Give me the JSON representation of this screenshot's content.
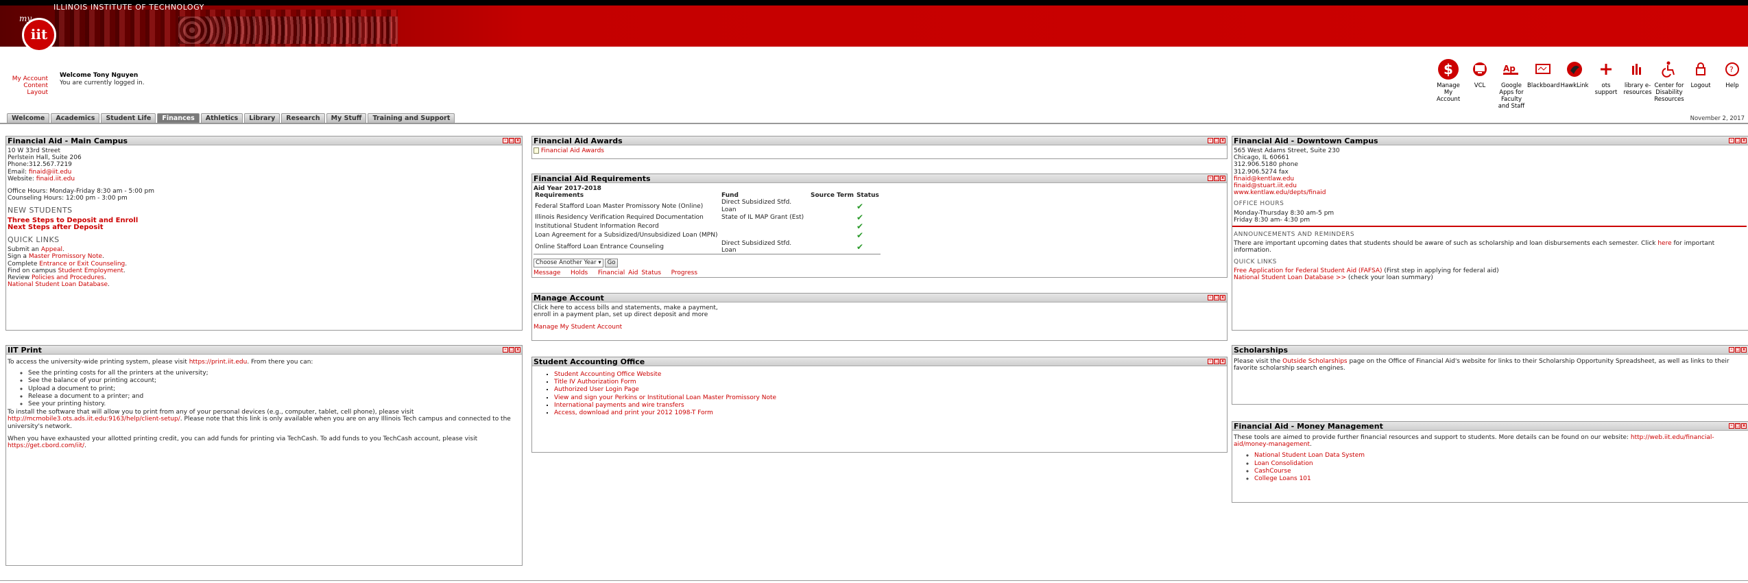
{
  "header": {
    "institution": "ILLINOIS INSTITUTE OF TECHNOLOGY",
    "logo_prefix": "my",
    "logo_text": "iit"
  },
  "user": {
    "my_account": "My Account",
    "content_layout": "Content Layout",
    "welcome": "Welcome Tony Nguyen",
    "logged_in": "You are currently logged in."
  },
  "toolbar": [
    {
      "label": "Manage My Account",
      "icon": "dollar-icon"
    },
    {
      "label": "VCL",
      "icon": "monitor-icon"
    },
    {
      "label": "Google Apps for Faculty and Staff",
      "icon": "google-apps-icon"
    },
    {
      "label": "Blackboard",
      "icon": "blackboard-icon"
    },
    {
      "label": "HawkLink",
      "icon": "hawklink-icon"
    },
    {
      "label": "ots support",
      "icon": "ots-icon"
    },
    {
      "label": "library e-resources",
      "icon": "library-icon"
    },
    {
      "label": "Center for Disability Resources",
      "icon": "accessibility-icon"
    },
    {
      "label": "Logout",
      "icon": "lock-icon"
    },
    {
      "label": "Help",
      "icon": "help-icon"
    }
  ],
  "tabs": [
    "Welcome",
    "Academics",
    "Student Life",
    "Finances",
    "Athletics",
    "Library",
    "Research",
    "My Stuff",
    "Training and Support"
  ],
  "date": "November 2, 2017",
  "fa_main": {
    "title": "Financial Aid - Main Campus",
    "address1": "10 W 33rd Street",
    "address2": "Perlstein Hall, Suite 206",
    "phone": "Phone:312.567.7219",
    "email_label": "Email: ",
    "email": "finaid@iit.edu",
    "website_label": "Website: ",
    "website": "finaid.iit.edu",
    "office_hours": "Office Hours: Monday-Friday 8:30 am - 5:00 pm",
    "counseling_hours": "Counseling Hours: 12:00 pm - 3:00 pm",
    "new_students": "NEW STUDENTS",
    "three_steps": "Three Steps to Deposit and Enroll",
    "next_steps": "Next Steps after Deposit",
    "quick_links": "QUICK LINKS",
    "ql": [
      {
        "pre": "Submit an ",
        "link": "Appeal",
        "post": "."
      },
      {
        "pre": "Sign a ",
        "link": "Master Promissory Note",
        "post": "."
      },
      {
        "pre": "Complete ",
        "link": "Entrance or Exit Counseling",
        "post": "."
      },
      {
        "pre": "Find on campus ",
        "link": "Student Employment",
        "post": "."
      },
      {
        "pre": "Review ",
        "link": "Policies and Procedures",
        "post": "."
      },
      {
        "pre": "",
        "link": "National Student Loan Database",
        "post": "."
      }
    ]
  },
  "iit_print": {
    "title": "IIT Print",
    "intro_pre": "To access the university-wide printing system, please visit ",
    "intro_link": "https://print.iit.edu",
    "intro_post": ". From there you can:",
    "items": [
      "See the printing costs for all the printers at the university;",
      "See the balance of your printing account;",
      "Upload a document to print;",
      "Release a document to a printer; and",
      "See your printing history."
    ],
    "install_pre": "To install the software that will allow you to print from any of your personal devices (e.g., computer, tablet, cell phone), please visit ",
    "install_link": "http://mcmobile3.ots.ads.iit.edu:9163/help/client-setup/",
    "install_post": ". Please note that this link is only available when you are on any Illinois Tech campus and connected to the university's network.",
    "funds_pre": "When you have exhausted your allotted printing credit, you can add funds for printing via TechCash. To add funds to you TechCash account, please visit ",
    "funds_link": "https://get.cbord.com/iit/",
    "funds_post": "."
  },
  "fa_awards": {
    "title": "Financial Aid Awards",
    "link": "Financial Aid Awards"
  },
  "fa_req": {
    "title": "Financial Aid Requirements",
    "aid_year": "Aid Year 2017-2018",
    "headers": [
      "Requirements",
      "Fund",
      "Source Term",
      "Status"
    ],
    "rows": [
      {
        "req": "Federal Stafford Loan Master Promissory Note (Online)",
        "fund": "Direct Subsidized Stfd. Loan"
      },
      {
        "req": "Illinois Residency Verification Required Documentation",
        "fund": "State of IL MAP Grant (Est)"
      },
      {
        "req": "Institutional Student Information Record",
        "fund": ""
      },
      {
        "req": "Loan Agreement for a Subsidized/Unsubsidized Loan (MPN)",
        "fund": ""
      },
      {
        "req": "Online Stafford Loan Entrance Counseling",
        "fund": "Direct Subsidized Stfd. Loan"
      }
    ],
    "status_mark": "✔",
    "select": "Choose Another Year",
    "go": "Go",
    "links": [
      "Message",
      "Holds",
      "Financial Aid Status",
      "Progress"
    ]
  },
  "manage": {
    "title": "Manage Account",
    "line1": "Click here to access bills and statements, make a payment,",
    "line2": "enroll in a payment plan, set up direct deposit and more",
    "link": "Manage My Student Account"
  },
  "sao": {
    "title": "Student Accounting Office",
    "links": [
      "Student Accounting Office Website",
      "Title IV Authorization Form",
      "Authorized User Login Page",
      "View and sign your Perkins or Institutional Loan Master Promissory Note",
      "International payments and wire transfers",
      "Access, download and print your 2012 1098-T Form"
    ]
  },
  "fa_down": {
    "title": "Financial Aid - Downtown Campus",
    "addr1": "565 West Adams Street, Suite 230",
    "addr2": "Chicago, IL 60661",
    "phone": "312.906.5180 phone",
    "fax": "312.906.5274 fax",
    "email1": "finaid@kentlaw.edu",
    "email2": "finaid@stuart.iit.edu",
    "web": "www.kentlaw.edu/depts/finaid",
    "office_hours": "OFFICE HOURS",
    "hours1": "Monday-Thursday 8:30 am-5 pm",
    "hours2": "Friday 8:30 am- 4:30 pm",
    "ann_title": "ANNOUNCEMENTS AND REMINDERS",
    "ann_pre": "There are important upcoming dates that students should be aware of such as scholarship and loan disbursements each semester. Click ",
    "ann_link": "here",
    "ann_post": " for important information.",
    "ql_title": "QUICK LINKS",
    "ql1_link": "Free Application for Federal Student Aid (FAFSA)",
    "ql1_post": " (First step in applying for federal aid)",
    "ql2_link": "National Student Loan Database >>",
    "ql2_post": " (check your loan summary)"
  },
  "scholarships": {
    "title": "Scholarships",
    "pre": "Please visit the ",
    "link": "Outside Scholarships",
    "post": " page on the Office of Financial Aid's website for links to their Scholarship Opportunity Spreadsheet, as well as links to their favorite scholarship search engines."
  },
  "money": {
    "title": "Financial Aid - Money Management",
    "pre": "These tools are aimed to provide further financial resources and support to students. More details can be found on our website: ",
    "link": "http://web.iit.edu/financial-aid/money-management",
    "post": ".",
    "items": [
      "National Student Loan Data System",
      "Loan Consolidation",
      "CashCourse",
      "College Loans 101"
    ]
  }
}
